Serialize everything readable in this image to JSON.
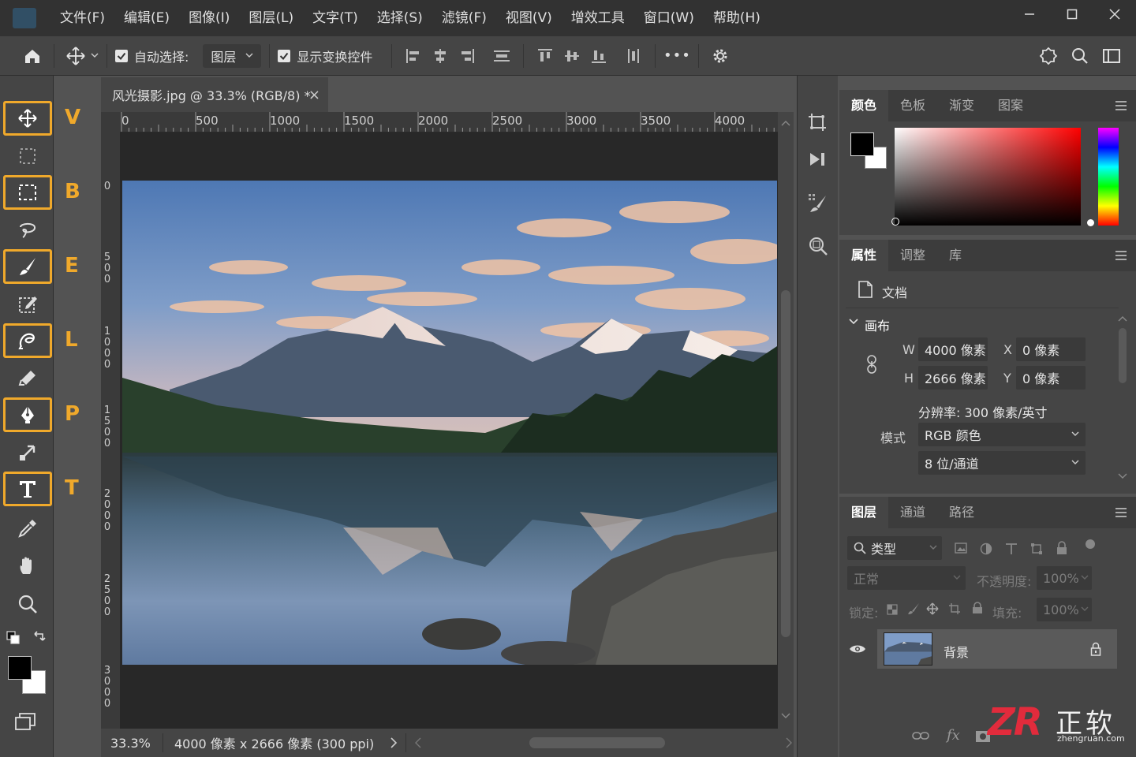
{
  "menubar": {
    "items": [
      "文件(F)",
      "编辑(E)",
      "图像(I)",
      "图层(L)",
      "文字(T)",
      "选择(S)",
      "滤镜(F)",
      "视图(V)",
      "增效工具",
      "窗口(W)",
      "帮助(H)"
    ]
  },
  "options": {
    "auto_select_label": "自动选择:",
    "auto_select_value": "图层",
    "show_transform_label": "显示变换控件",
    "more": "•••"
  },
  "toolbar": {
    "letters": [
      "V",
      "B",
      "E",
      "L",
      "P",
      "T"
    ]
  },
  "document": {
    "tab_title": "风光摄影.jpg @ 33.3% (RGB/8) *",
    "close": "×"
  },
  "rulers": {
    "h": [
      "0",
      "500",
      "1000",
      "1500",
      "2000",
      "2500",
      "3000",
      "3500",
      "4000"
    ],
    "v": [
      "0",
      "500",
      "1000",
      "1500",
      "2000",
      "2500",
      "3000"
    ]
  },
  "status": {
    "zoom": "33.3%",
    "info": "4000 像素 x 2666 像素 (300 ppi)"
  },
  "color_panel": {
    "tabs": [
      "颜色",
      "色板",
      "渐变",
      "图案"
    ]
  },
  "properties_panel": {
    "tabs": [
      "属性",
      "调整",
      "库"
    ],
    "doc_label": "文档",
    "canvas_label": "画布",
    "w_label": "W",
    "w_value": "4000 像素",
    "h_label": "H",
    "h_value": "2666 像素",
    "x_label": "X",
    "x_value": "0 像素",
    "y_label": "Y",
    "y_value": "0 像素",
    "resolution": "分辨率: 300 像素/英寸",
    "mode_label": "模式",
    "mode_value": "RGB 颜色",
    "depth_value": "8 位/通道"
  },
  "layers_panel": {
    "tabs": [
      "图层",
      "通道",
      "路径"
    ],
    "filter_label": "类型",
    "blend_mode": "正常",
    "opacity_label": "不透明度:",
    "opacity_value": "100%",
    "lock_label": "锁定:",
    "fill_label": "填充:",
    "fill_value": "100%",
    "layer_name": "背景",
    "fx": "fx"
  },
  "watermark": {
    "logo": "ZR",
    "name": "正软",
    "url": "zhengruan.com"
  }
}
